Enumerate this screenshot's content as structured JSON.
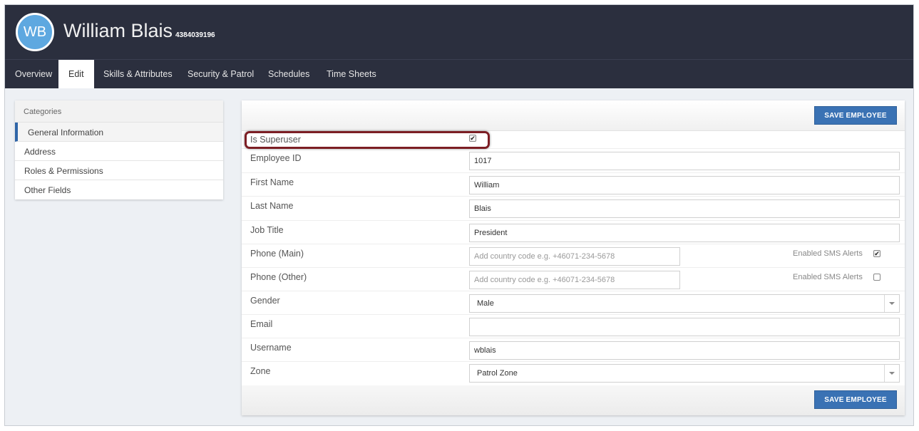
{
  "header": {
    "initials": "WB",
    "name": "William Blais",
    "number": "4384039196"
  },
  "tabs": [
    {
      "label": "Overview"
    },
    {
      "label": "Edit"
    },
    {
      "label": "Skills & Attributes"
    },
    {
      "label": "Security & Patrol"
    },
    {
      "label": "Schedules"
    },
    {
      "label": "Time Sheets"
    }
  ],
  "sidebar": {
    "heading": "Categories",
    "items": [
      {
        "label": "General Information"
      },
      {
        "label": "Address"
      },
      {
        "label": "Roles & Permissions"
      },
      {
        "label": "Other Fields"
      }
    ]
  },
  "form": {
    "save_label": "SAVE EMPLOYEE",
    "superuser": {
      "label": "Is Superuser",
      "checked": true
    },
    "employee_id": {
      "label": "Employee ID",
      "value": "1017"
    },
    "first_name": {
      "label": "First Name",
      "value": "William"
    },
    "last_name": {
      "label": "Last Name",
      "value": "Blais"
    },
    "job_title": {
      "label": "Job Title",
      "value": "President"
    },
    "phone_main": {
      "label": "Phone (Main)",
      "placeholder": "Add country code e.g. +46071-234-5678",
      "sms_label": "Enabled SMS Alerts",
      "sms_checked": true
    },
    "phone_other": {
      "label": "Phone (Other)",
      "placeholder": "Add country code e.g. +46071-234-5678",
      "sms_label": "Enabled SMS Alerts",
      "sms_checked": false
    },
    "gender": {
      "label": "Gender",
      "value": "Male"
    },
    "email": {
      "label": "Email",
      "value": ""
    },
    "username": {
      "label": "Username",
      "value": "wblais"
    },
    "zone": {
      "label": "Zone",
      "value": "Patrol Zone"
    }
  },
  "icons": {
    "checkmark": "✔",
    "select_arrow": "chevron-down-icon"
  }
}
